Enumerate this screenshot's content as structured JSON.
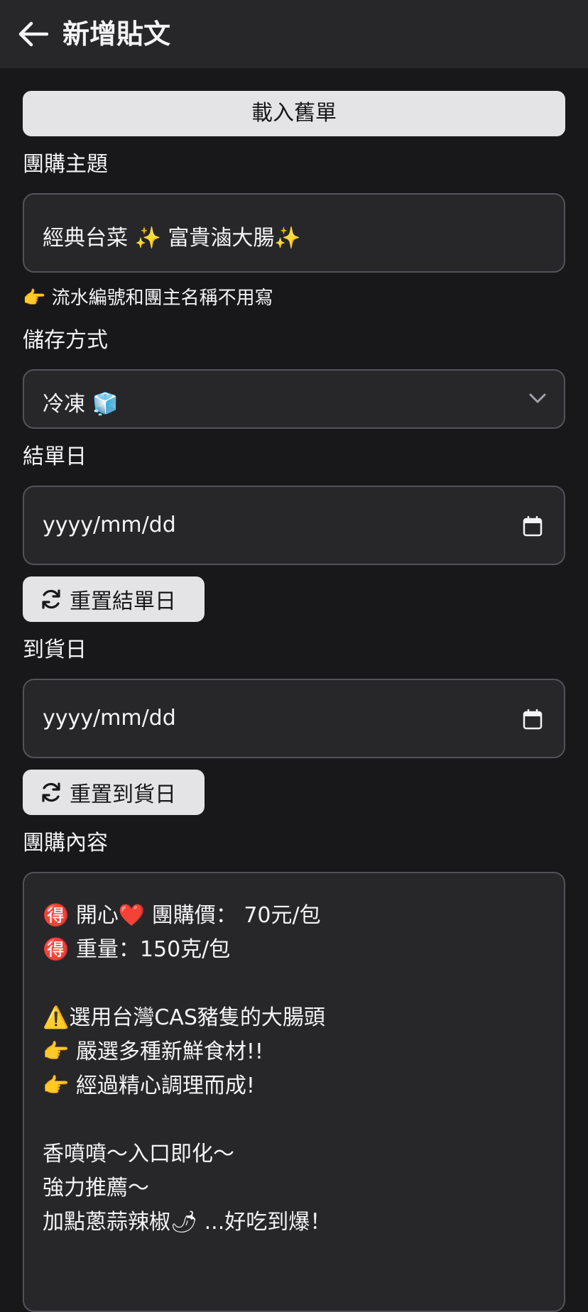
{
  "appbar": {
    "back_icon": "arrow-left-icon",
    "title": "新增貼文"
  },
  "load_button": {
    "label": "載入舊單"
  },
  "topic": {
    "label": "團購主題",
    "value": "經典台菜 ✨ 富貴滷大腸✨"
  },
  "hint": {
    "text": "👉 流水編號和團主名稱不用寫"
  },
  "storage": {
    "label": "儲存方式",
    "value": "冷凍 🧊",
    "icon": "chevron-down-icon"
  },
  "close_date": {
    "label": "結單日",
    "placeholder": "yyyy/mm/dd",
    "icon": "calendar-icon",
    "reset_label": "重置結單日",
    "reset_icon": "refresh-icon"
  },
  "arrival_date": {
    "label": "到貨日",
    "placeholder": "yyyy/mm/dd",
    "icon": "calendar-icon",
    "reset_label": "重置到貨日",
    "reset_icon": "refresh-icon"
  },
  "content": {
    "label": "團購內容",
    "lines": [
      "🉐 開心❤️ 團購價： 70元/包",
      "🉐 重量：150克/包",
      "",
      "⚠️選用台灣CAS豬隻的大腸頭",
      "👉 嚴選多種新鮮食材!!",
      "👉 經過精心調理而成!",
      "",
      "香噴噴～入口即化～",
      "強力推薦～",
      "加點蔥蒜辣椒🌶 ...好吃到爆！"
    ]
  },
  "colors": {
    "background": "#18181b",
    "appbar": "#27272a",
    "field": "#27272a",
    "border": "#52525b",
    "button": "#e4e4e7",
    "text": "#f4f4f5"
  }
}
